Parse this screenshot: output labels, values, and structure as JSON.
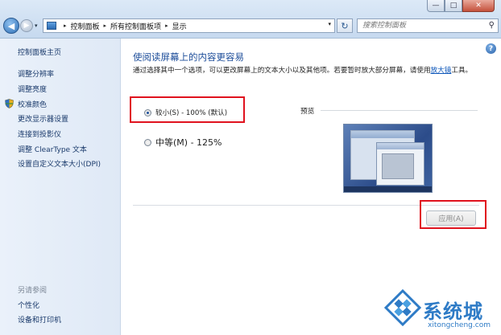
{
  "window": {
    "min_glyph": "—",
    "max_glyph": "□",
    "close_glyph": "✕"
  },
  "address_bar": {
    "crumbs": [
      "控制面板",
      "所有控制面板项",
      "显示"
    ],
    "separator": "▸",
    "dropdown_glyph": "▾"
  },
  "nav": {
    "back_glyph": "◀",
    "forward_glyph": "▶",
    "refresh_glyph": "↻"
  },
  "search": {
    "placeholder": "搜索控制面板",
    "icon": "search-icon"
  },
  "sidebar": {
    "home": "控制面板主页",
    "items": [
      "调整分辨率",
      "调整亮度",
      "校准颜色",
      "更改显示器设置",
      "连接到投影仪",
      "调整 ClearType 文本",
      "设置自定义文本大小(DPI)"
    ],
    "see_also_title": "另请参阅",
    "see_also": [
      "个性化",
      "设备和打印机"
    ]
  },
  "main": {
    "heading": "使阅读屏幕上的内容更容易",
    "description_pre": "通过选择其中一个选项，可以更改屏幕上的文本大小以及其他项。若要暂时放大部分屏幕，请使用",
    "description_link": "放大镜",
    "description_post": "工具。",
    "options": [
      {
        "label": "较小(S) - 100% (默认)",
        "selected": true
      },
      {
        "label": "中等(M) - 125%",
        "selected": false
      }
    ],
    "preview_label": "预览",
    "apply_button": "应用(A)",
    "help_glyph": "?"
  },
  "watermark": {
    "brand": "系统城",
    "url": "xitongcheng.com"
  },
  "colors": {
    "accent": "#1e4e9a",
    "link": "#0b55b9",
    "highlight": "#e0121e",
    "watermark": "#2e7bc6"
  }
}
